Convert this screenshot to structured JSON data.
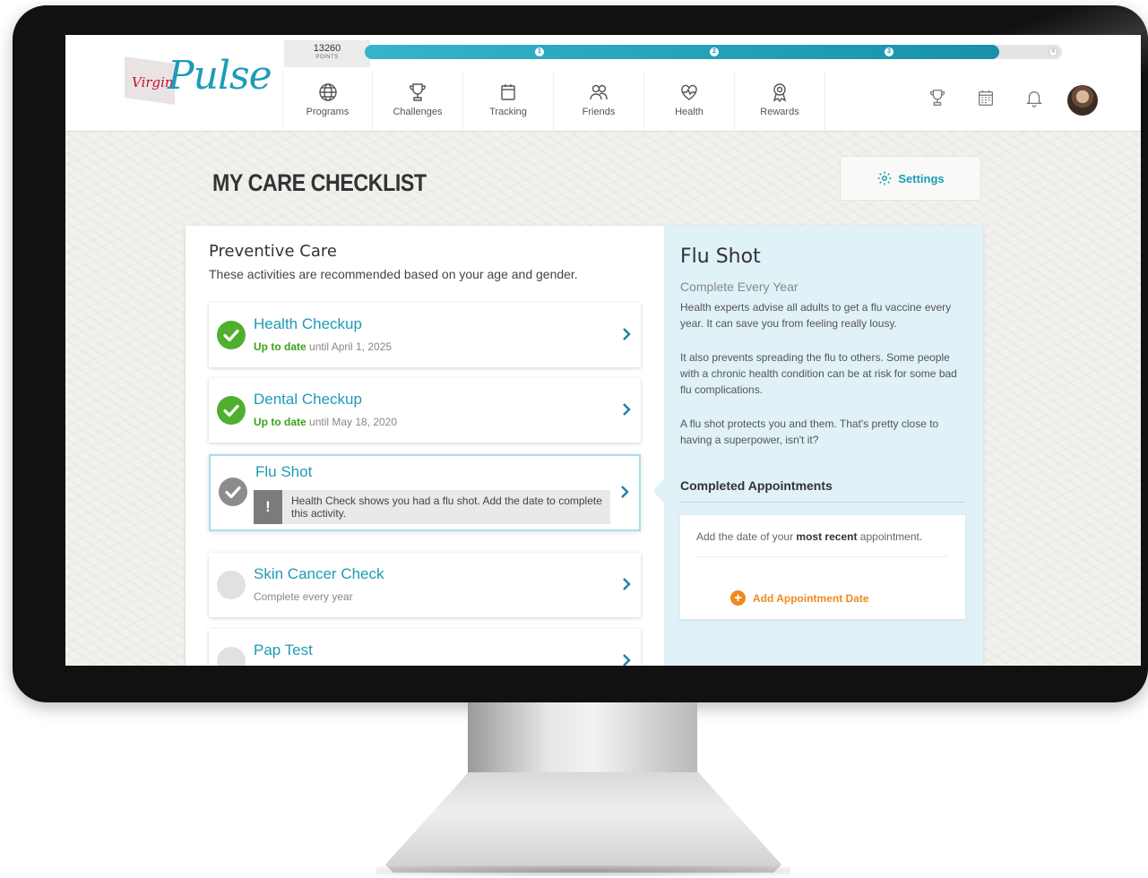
{
  "brand": {
    "virgin": "Virgin",
    "pulse": "Pulse"
  },
  "points": {
    "value": "13260",
    "label": "POINTS"
  },
  "progress": {
    "fill_fraction": 0.91,
    "markers": [
      "1",
      "2",
      "3",
      "4"
    ]
  },
  "nav": [
    {
      "label": "Programs",
      "icon": "globe-icon"
    },
    {
      "label": "Challenges",
      "icon": "trophy-icon"
    },
    {
      "label": "Tracking",
      "icon": "tracking-icon"
    },
    {
      "label": "Friends",
      "icon": "friends-icon"
    },
    {
      "label": "Health",
      "icon": "heart-pulse-icon"
    },
    {
      "label": "Rewards",
      "icon": "rewards-icon"
    }
  ],
  "header_icons": [
    "trophy-icon",
    "calendar-icon",
    "bell-icon"
  ],
  "page": {
    "title": "MY CARE CHECKLIST",
    "settings_label": "Settings"
  },
  "checklist": {
    "title": "Preventive Care",
    "description": "These activities are recommended based on your age and gender.",
    "items": [
      {
        "title": "Health Checkup",
        "status_label": "Up to date",
        "detail": "until April 1, 2025",
        "state": "done"
      },
      {
        "title": "Dental Checkup",
        "status_label": "Up to date",
        "detail": "until May 18, 2020",
        "state": "done"
      },
      {
        "title": "Flu Shot",
        "alert": "Health Check shows you had a flu shot. Add the date to complete this activity.",
        "state": "pending"
      },
      {
        "title": "Skin Cancer Check",
        "detail": "Complete every year",
        "state": "empty"
      },
      {
        "title": "Pap Test",
        "state": "empty"
      }
    ]
  },
  "detail": {
    "title": "Flu Shot",
    "frequency": "Complete Every Year",
    "paragraphs": [
      "Health experts advise all adults to get a flu vaccine every year. It can save you from feeling really lousy.",
      "It also prevents spreading the flu to others. Some people with a chronic health condition can be at risk for some bad flu complications.",
      "A flu shot protects you and them. That's pretty close to having a superpower, isn't it?"
    ],
    "completed_heading": "Completed Appointments",
    "appointment_prompt_pre": "Add the date of your",
    "appointment_prompt_bold": "most recent",
    "appointment_prompt_post": "appointment.",
    "add_label": "Add Appointment Date"
  },
  "colors": {
    "accent": "#1e9bb6",
    "success": "#4fb02f",
    "warning": "#f08a1d",
    "detail_bg": "#e0f1f8"
  }
}
